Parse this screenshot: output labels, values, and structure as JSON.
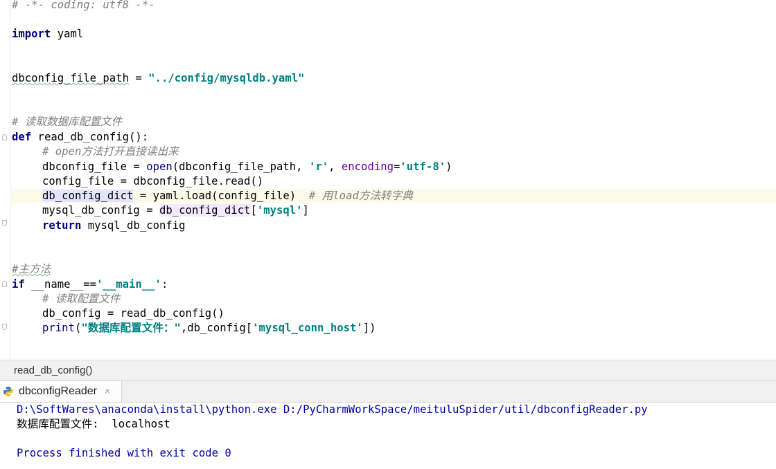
{
  "editor": {
    "lines": {
      "l1": "# -*- coding: utf8 -*-",
      "l2_kw": "import",
      "l2_mod": " yaml",
      "l3_var": "dbconfig_file_path",
      "l3_eq": " = ",
      "l3_str": "\"../config/mysqldb.yaml\"",
      "l4": "# 读取数据库配置文件",
      "l5_kw": "def",
      "l5_rest": " read_db_config():",
      "l6": "# open方法打开直接读出来",
      "l7_a": "dbconfig_file = ",
      "l7_open": "open",
      "l7_b": "(dbconfig_file_path, ",
      "l7_r": "'r'",
      "l7_c": ", ",
      "l7_enc": "encoding",
      "l7_d": "=",
      "l7_utf": "'utf-8'",
      "l7_e": ")",
      "l8": "config_file = dbconfig_file.read()",
      "l9_var": "db_config_dict",
      "l9_rest": " = yaml.load(config_file)  ",
      "l9_cm": "# 用load方法转字典",
      "l10_a": "mysql_db_config = ",
      "l10_ref": "db_config_dict",
      "l10_b": "[",
      "l10_key": "'mysql'",
      "l10_c": "]",
      "l11_kw": "return",
      "l11_rest": " mysql_db_config",
      "l12": "#主方法",
      "l13_kw": "if",
      "l13_a": " ",
      "l13_name": "__name__",
      "l13_b": "==",
      "l13_main": "'__main__'",
      "l13_c": ":",
      "l14": "# 读取配置文件",
      "l15": "db_config = read_db_config()",
      "l16_print": "print",
      "l16_a": "(",
      "l16_str": "\"数据库配置文件：\"",
      "l16_b": ",db_config[",
      "l16_key": "'mysql_conn_host'",
      "l16_c": "])"
    }
  },
  "breadcrumb": {
    "label": "read_db_config()"
  },
  "run_panel": {
    "tab_label": "dbconfigReader",
    "close_glyph": "×",
    "console": {
      "command": "D:\\SoftWares\\anaconda\\install\\python.exe D:/PyCharmWorkSpace/meituluSpider/util/dbconfigReader.py",
      "output": "数据库配置文件:  localhost",
      "exit": "Process finished with exit code 0"
    }
  },
  "colors": {
    "keyword": "#000080",
    "comment": "#808080",
    "string": "#008080",
    "current_line": "#fcfae8"
  }
}
